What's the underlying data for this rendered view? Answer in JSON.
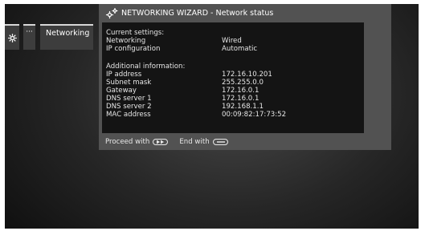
{
  "menu": {
    "items": [
      {
        "icon": "gear-icon"
      },
      {
        "label": "···"
      },
      {
        "label": "Networking"
      }
    ]
  },
  "wizard": {
    "title": "NETWORKING WIZARD - Network status",
    "current_settings": {
      "heading": "Current settings:",
      "rows": [
        {
          "label": "Networking",
          "value": "Wired"
        },
        {
          "label": "IP configuration",
          "value": "Automatic"
        }
      ]
    },
    "additional_information": {
      "heading": "Additional information:",
      "rows": [
        {
          "label": "IP address",
          "value": "172.16.10.201"
        },
        {
          "label": "Subnet mask",
          "value": "255.255.0.0"
        },
        {
          "label": "Gateway",
          "value": "172.16.0.1"
        },
        {
          "label": "DNS server 1",
          "value": "172.16.0.1"
        },
        {
          "label": "DNS server 2",
          "value": "192.168.1.1"
        },
        {
          "label": "MAC address",
          "value": "00:09:82:17:73:52"
        }
      ]
    },
    "footer": {
      "proceed_label": "Proceed with",
      "end_label": "End with",
      "proceed_key_icon": "fast-forward-key-icon",
      "end_key_icon": "back-key-icon"
    }
  }
}
